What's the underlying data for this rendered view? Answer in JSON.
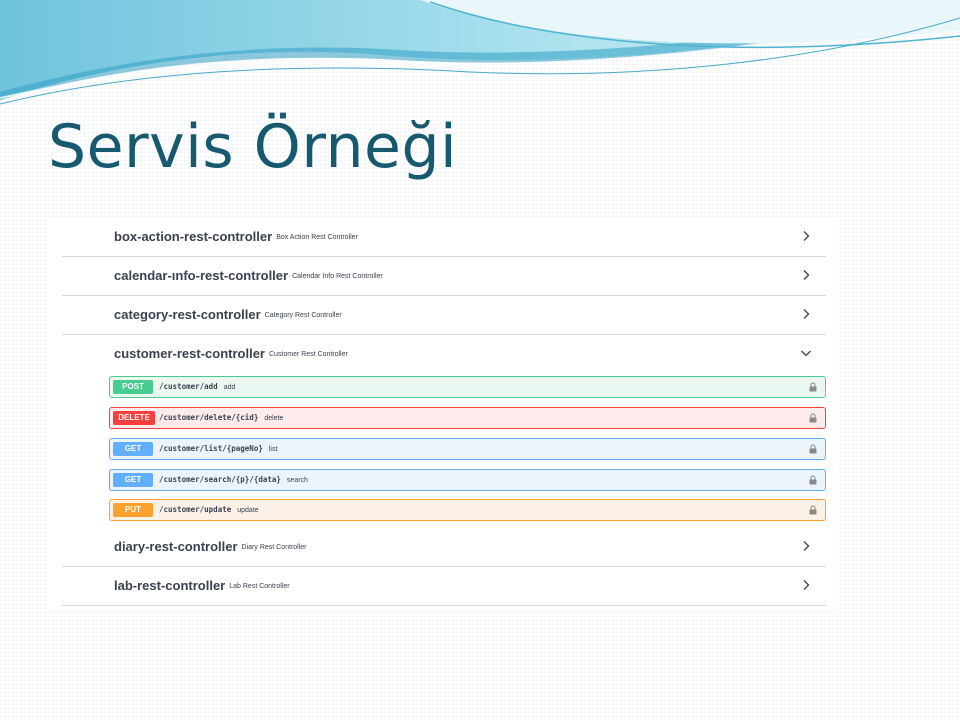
{
  "slide": {
    "title": "Servis Örneği"
  },
  "colors": {
    "title": "#17596f",
    "post": "#49cc90",
    "delete": "#f93e3e",
    "get": "#61affe",
    "put": "#fca130"
  },
  "controllers": [
    {
      "name": "box-action-rest-controller",
      "description": "Box Action Rest Controller",
      "state": "collapsed"
    },
    {
      "name": "calendar-ınfo-rest-controller",
      "description": "Calendar Info Rest Controller",
      "state": "collapsed"
    },
    {
      "name": "category-rest-controller",
      "description": "Category Rest Controller",
      "state": "collapsed"
    },
    {
      "name": "customer-rest-controller",
      "description": "Customer Rest Controller",
      "state": "expanded"
    },
    {
      "name": "diary-rest-controller",
      "description": "Diary Rest Controller",
      "state": "collapsed"
    },
    {
      "name": "lab-rest-controller",
      "description": "Lab Rest Controller",
      "state": "collapsed"
    }
  ],
  "operations": [
    {
      "method": "POST",
      "path": "/customer/add",
      "summary": "add",
      "icon": "lock-icon"
    },
    {
      "method": "DELETE",
      "path": "/customer/delete/{cid}",
      "summary": "delete",
      "icon": "lock-icon"
    },
    {
      "method": "GET",
      "path": "/customer/list/{pageNo}",
      "summary": "list",
      "icon": "lock-icon"
    },
    {
      "method": "GET",
      "path": "/customer/search/{p}/{data}",
      "summary": "search",
      "icon": "lock-icon"
    },
    {
      "method": "PUT",
      "path": "/customer/update",
      "summary": "update",
      "icon": "lock-icon"
    }
  ]
}
